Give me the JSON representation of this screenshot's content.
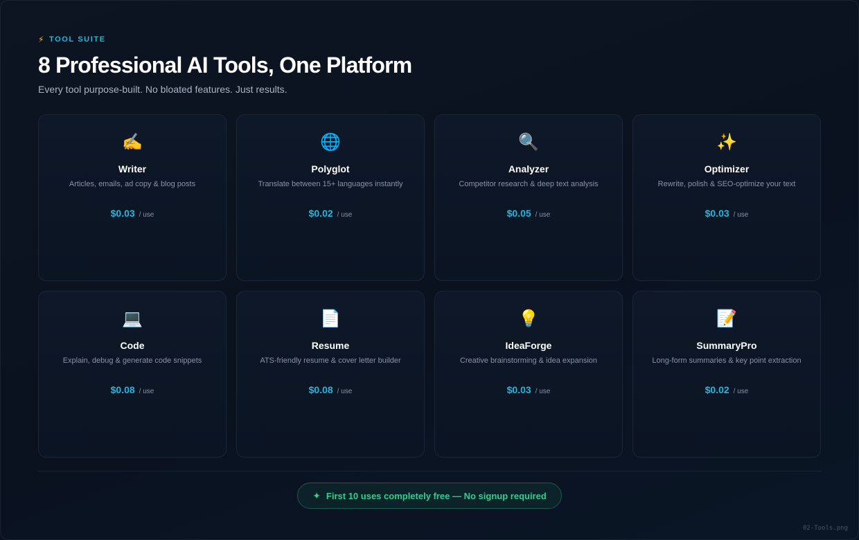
{
  "header": {
    "eyebrow_icon": "⚡",
    "eyebrow": "TOOL SUITE",
    "title": "8 Professional AI Tools, One Platform",
    "subtitle": "Every tool purpose-built. No bloated features. Just results."
  },
  "tools": [
    {
      "icon": "✍️",
      "icon_name": "writing-hand-icon",
      "name": "Writer",
      "desc": "Articles, emails, ad copy & blog posts",
      "price": "$0.03",
      "unit": "/ use"
    },
    {
      "icon": "🌐",
      "icon_name": "globe-icon",
      "name": "Polyglot",
      "desc": "Translate between 15+ languages instantly",
      "price": "$0.02",
      "unit": "/ use"
    },
    {
      "icon": "🔍",
      "icon_name": "magnifier-icon",
      "name": "Analyzer",
      "desc": "Competitor research & deep text analysis",
      "price": "$0.05",
      "unit": "/ use"
    },
    {
      "icon": "✨",
      "icon_name": "sparkles-icon",
      "name": "Optimizer",
      "desc": "Rewrite, polish & SEO-optimize your text",
      "price": "$0.03",
      "unit": "/ use"
    },
    {
      "icon": "💻",
      "icon_name": "laptop-icon",
      "name": "Code",
      "desc": "Explain, debug & generate code snippets",
      "price": "$0.08",
      "unit": "/ use"
    },
    {
      "icon": "📄",
      "icon_name": "document-icon",
      "name": "Resume",
      "desc": "ATS-friendly resume & cover letter builder",
      "price": "$0.08",
      "unit": "/ use"
    },
    {
      "icon": "💡",
      "icon_name": "lightbulb-icon",
      "name": "IdeaForge",
      "desc": "Creative brainstorming & idea expansion",
      "price": "$0.03",
      "unit": "/ use"
    },
    {
      "icon": "📝",
      "icon_name": "memo-icon",
      "name": "SummaryPro",
      "desc": "Long-form summaries & key point extraction",
      "price": "$0.02",
      "unit": "/ use"
    }
  ],
  "promo": {
    "icon": "✦",
    "text": "First 10 uses completely free — No signup required"
  },
  "filename": "02-Tools.png",
  "colors": {
    "accent": "#1fb8e0",
    "promo_green": "#2fd190",
    "background": "#0b1322"
  }
}
